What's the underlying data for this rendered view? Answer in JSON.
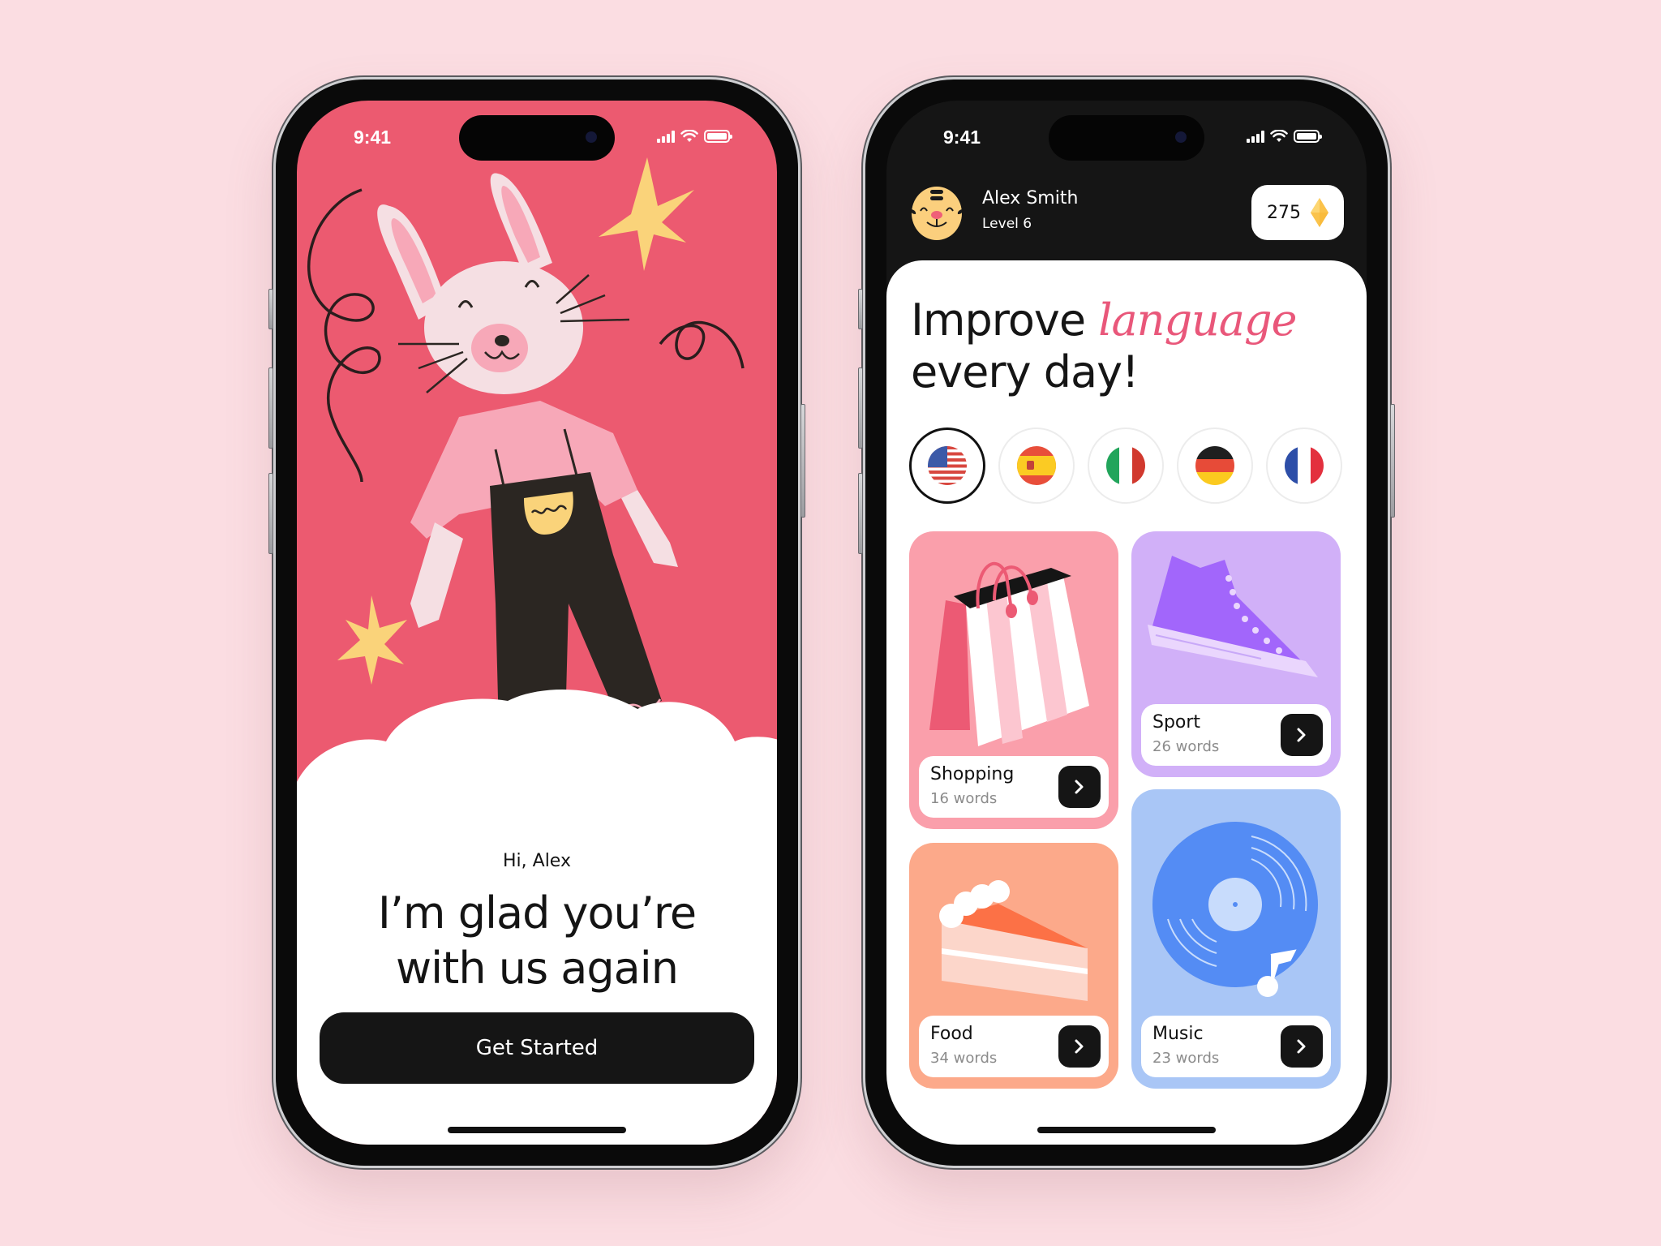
{
  "status_bar": {
    "time": "9:41"
  },
  "welcome_screen": {
    "greeting": "Hi, Alex",
    "headline_line1": "I’m glad you’re",
    "headline_line2": "with us again",
    "cta_label": "Get Started",
    "illustration": "bunny-in-overalls",
    "colors": {
      "background": "#ec5a70",
      "button": "#151515"
    }
  },
  "home_screen": {
    "user": {
      "name": "Alex Smith",
      "level": "Level 6",
      "avatar": "tiger-avatar"
    },
    "coins": {
      "value": "275",
      "icon": "gem-icon"
    },
    "title": {
      "prefix": "Improve ",
      "accent": "language",
      "suffix": "every day!"
    },
    "accent_color": "#e9577a",
    "languages": [
      {
        "code": "us",
        "name": "English (US)",
        "selected": true
      },
      {
        "code": "es",
        "name": "Spanish",
        "selected": false
      },
      {
        "code": "it",
        "name": "Italian",
        "selected": false
      },
      {
        "code": "de",
        "name": "German",
        "selected": false
      },
      {
        "code": "fr",
        "name": "French",
        "selected": false
      }
    ],
    "categories": [
      {
        "title": "Shopping",
        "count": "16 words",
        "color": "#fa9fab",
        "icon": "shopping-bag"
      },
      {
        "title": "Sport",
        "count": "26 words",
        "color": "#d1b0f8",
        "icon": "sneaker"
      },
      {
        "title": "Food",
        "count": "34 words",
        "color": "#fca98a",
        "icon": "cake-slice"
      },
      {
        "title": "Music",
        "count": "23 words",
        "color": "#a9c6f6",
        "icon": "vinyl-record"
      }
    ]
  }
}
